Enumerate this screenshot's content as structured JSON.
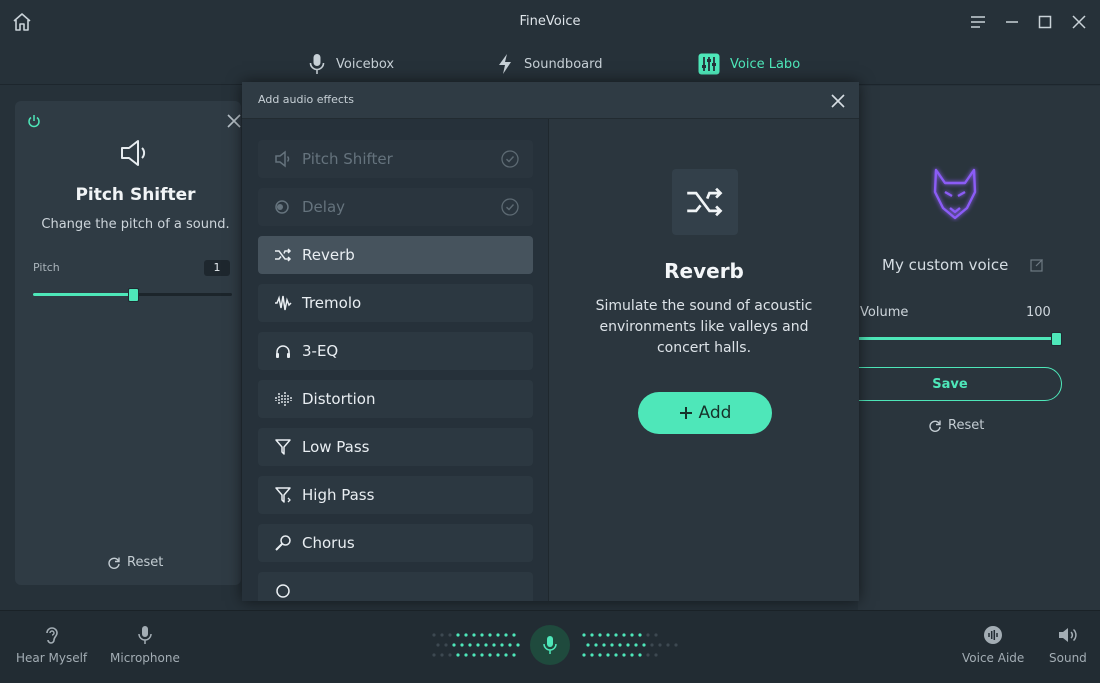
{
  "window": {
    "title": "FineVoice",
    "controls": [
      "menu-icon",
      "minimize-icon",
      "maximize-icon",
      "close-icon"
    ]
  },
  "tabs": [
    {
      "label": "Voicebox",
      "icon": "microphone-icon"
    },
    {
      "label": "Soundboard",
      "icon": "lightning-icon"
    },
    {
      "label": "Voice Labo",
      "icon": "sliders-icon",
      "active": true
    }
  ],
  "left_card": {
    "title": "Pitch Shifter",
    "description": "Change the pitch of a sound.",
    "pitch_label": "Pitch",
    "pitch_value": "1",
    "pitch_slider_fraction": 0.5,
    "reset_label": "Reset"
  },
  "dialog": {
    "title": "Add audio effects",
    "effects": [
      {
        "label": "Pitch Shifter",
        "icon": "speaker-icon",
        "state": "added"
      },
      {
        "label": "Delay",
        "icon": "delay-icon",
        "state": "added"
      },
      {
        "label": "Reverb",
        "icon": "shuffle-icon",
        "state": "selected"
      },
      {
        "label": "Tremolo",
        "icon": "waveform-icon",
        "state": "normal"
      },
      {
        "label": "3-EQ",
        "icon": "headphones-icon",
        "state": "normal"
      },
      {
        "label": "Distortion",
        "icon": "distortion-icon",
        "state": "normal"
      },
      {
        "label": "Low Pass",
        "icon": "filter-icon",
        "state": "normal"
      },
      {
        "label": "High Pass",
        "icon": "filter-icon",
        "state": "normal"
      },
      {
        "label": "Chorus",
        "icon": "microphone-icon",
        "state": "normal"
      }
    ],
    "detail": {
      "title": "Reverb",
      "description": "Simulate the sound of acoustic environments like valleys and concert halls.",
      "add_label": "Add"
    }
  },
  "right_panel": {
    "voice_name": "My custom voice",
    "volume_label": "Volume",
    "volume_value": "100",
    "volume_fraction": 1.0,
    "save_label": "Save",
    "reset_label": "Reset"
  },
  "bottom_bar": {
    "hear_myself": "Hear Myself",
    "microphone": "Microphone",
    "voice_aide": "Voice Aide",
    "sound": "Sound"
  },
  "colors": {
    "accent": "#4ee7b9",
    "background": "#263139",
    "panel": "#2f3b44",
    "avatar_glow": "#8b5cf6"
  }
}
